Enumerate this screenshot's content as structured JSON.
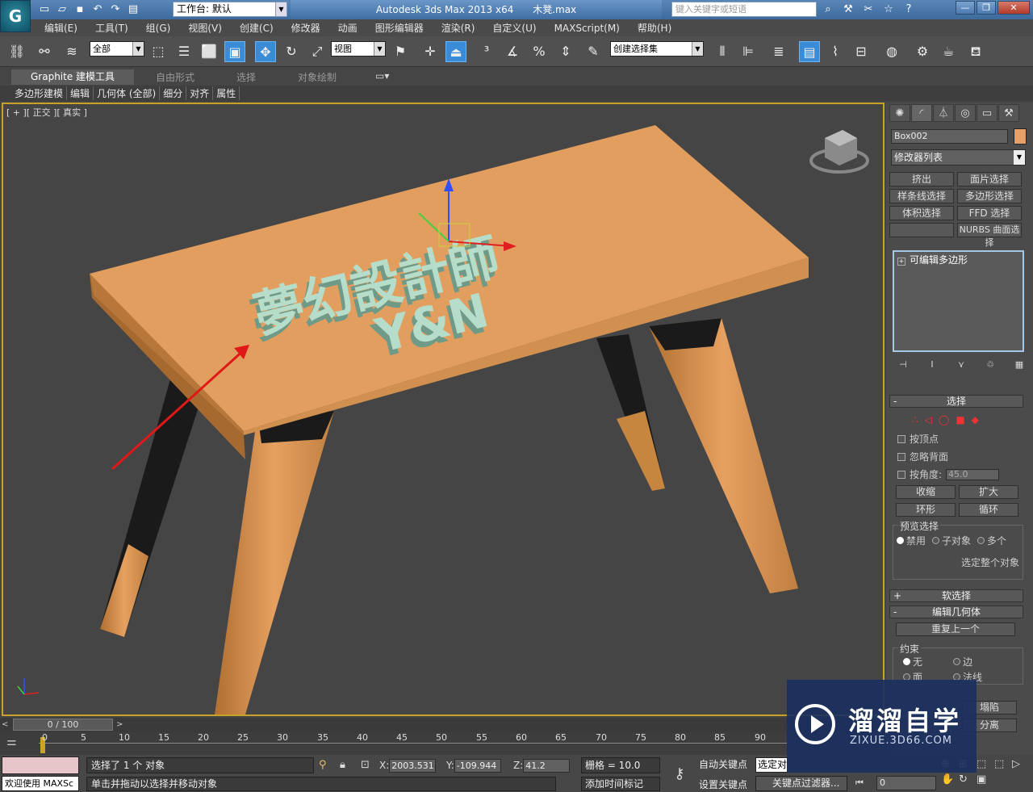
{
  "titlebar": {
    "workspace_label": "工作台: 默认",
    "app_title": "Autodesk 3ds Max  2013 x64",
    "file_name": "木凳.max",
    "search_placeholder": "键入关键字或短语"
  },
  "menu": [
    "编辑(E)",
    "工具(T)",
    "组(G)",
    "视图(V)",
    "创建(C)",
    "修改器",
    "动画",
    "图形编辑器",
    "渲染(R)",
    "自定义(U)",
    "MAXScript(M)",
    "帮助(H)"
  ],
  "toolbar": {
    "selection_filter": "全部",
    "ref_coord": "视图",
    "named_selection": "创建选择集"
  },
  "ribbon": {
    "tabs": [
      "Graphite 建模工具",
      "自由形式",
      "选择",
      "对象绘制"
    ],
    "subtabs": [
      "多边形建模",
      "编辑",
      "几何体 (全部)",
      "细分",
      "对齐",
      "属性"
    ]
  },
  "viewport": {
    "label": "[ + ][ 正交 ][ 真实 ]",
    "scene_text_line1": "夢幻設計師",
    "scene_text_line2": "Y&N"
  },
  "command_panel": {
    "object_name": "Box002",
    "object_color": "#e6a068",
    "modifier_list": "修改器列表",
    "modifier_buttons": [
      "挤出",
      "面片选择",
      "样条线选择",
      "多边形选择",
      "体积选择",
      "FFD 选择",
      "",
      "NURBS 曲面选择"
    ],
    "stack_item": "可编辑多边形",
    "selection": {
      "title": "选择",
      "by_vertex": "按顶点",
      "ignore_backfacing": "忽略背面",
      "by_angle": "按角度:",
      "angle_value": "45.0",
      "shrink": "收缩",
      "grow": "扩大",
      "ring": "环形",
      "loop": "循环",
      "preview_title": "预览选择",
      "preview_options": [
        "禁用",
        "子对象",
        "多个"
      ],
      "select_whole": "选定整个对象"
    },
    "soft_selection": "软选择",
    "edit_geometry": "编辑几何体",
    "repeat_last": "重复上一个",
    "constraints": {
      "title": "约束",
      "options": [
        "无",
        "边",
        "面",
        "法线"
      ]
    },
    "collapse": "塌陷",
    "detach": "分离"
  },
  "timeline": {
    "slider_label": "0 / 100",
    "ticks": [
      "0",
      "5",
      "10",
      "15",
      "20",
      "25",
      "30",
      "35",
      "40",
      "45",
      "50",
      "55",
      "60",
      "65",
      "70",
      "75",
      "80",
      "85",
      "90"
    ]
  },
  "status": {
    "selected": "选择了 1 个 对象",
    "prompt": "单击并拖动以选择并移动对象",
    "maxscript": "欢迎使用 MAXSc",
    "x_label": "X:",
    "x": "2003.531",
    "y_label": "Y:",
    "y": "-109.944",
    "z_label": "Z:",
    "z": "41.2",
    "grid": "栅格 = 10.0",
    "add_time_tag": "添加时间标记",
    "auto_key": "自动关键点",
    "set_key": "设置关键点",
    "selected_combo": "选定对象",
    "key_filters": "关键点过滤器...",
    "frame": "0"
  },
  "watermark": {
    "title": "溜溜自学",
    "url": "ZIXUE.3D66.COM"
  }
}
